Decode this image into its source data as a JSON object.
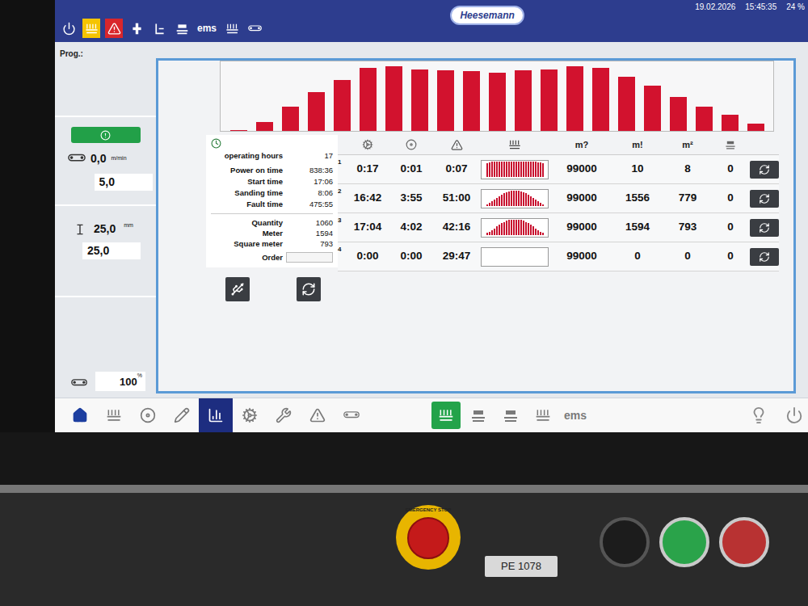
{
  "header": {
    "logo": "Heesemann",
    "date": "19.02.2026",
    "time": "15:45:35",
    "percent": "24 %",
    "icons": [
      {
        "kind": "power",
        "alert": false,
        "color": "#ffffff"
      },
      {
        "kind": "unit",
        "alert": true,
        "color": "#f5c400"
      },
      {
        "kind": "warning",
        "alert": true,
        "color": "#d9262c"
      },
      {
        "kind": "sensor",
        "alert": false,
        "color": "#ffffff"
      },
      {
        "kind": "thickness",
        "alert": false,
        "color": "#ffffff"
      },
      {
        "kind": "belt",
        "alert": false,
        "color": "#ffffff"
      },
      {
        "kind": "text",
        "label": "ems",
        "alert": false,
        "color": "#ffffff"
      },
      {
        "kind": "units",
        "alert": false,
        "color": "#ffffff"
      },
      {
        "kind": "conveyor",
        "alert": false,
        "color": "#ffffff"
      }
    ]
  },
  "program": {
    "label": "Prog.:"
  },
  "left_panel": {
    "status_ok": true,
    "feed": {
      "value": "0,0",
      "unit": "m/min",
      "setpoint": "5,0"
    },
    "thickness": {
      "value": "25,0",
      "unit": "mm",
      "setpoint": "25,0"
    },
    "speed": {
      "value": "100",
      "unit": "%"
    }
  },
  "chart": {
    "values": [
      1,
      14,
      37,
      60,
      79,
      97,
      100,
      95,
      94,
      92,
      90,
      94,
      95,
      100,
      97,
      84,
      70,
      52,
      37,
      25,
      11
    ]
  },
  "stats": {
    "title": "operating hours",
    "title_value": "17",
    "times": [
      {
        "label": "Power on time",
        "value": "838:36"
      },
      {
        "label": "Start time",
        "value": "17:06"
      },
      {
        "label": "Sanding time",
        "value": "8:06"
      },
      {
        "label": "Fault time",
        "value": "475:55"
      }
    ],
    "counts": [
      {
        "label": "Quantity",
        "value": "1060"
      },
      {
        "label": "Meter",
        "value": "1594"
      },
      {
        "label": "Square meter",
        "value": "793"
      }
    ],
    "order": {
      "label": "Order",
      "value": ""
    }
  },
  "table": {
    "columns": [
      "m?",
      "m!",
      "m²"
    ],
    "rows": [
      {
        "index": "1",
        "t1": "0:17",
        "t2": "0:01",
        "t3": "0:07",
        "profile": [
          88,
          92,
          95,
          96,
          97,
          98,
          98,
          99,
          99,
          100,
          100,
          100,
          100,
          100,
          99,
          99,
          98,
          98,
          97,
          96,
          95,
          94,
          92,
          88
        ],
        "target": "99000",
        "m": "10",
        "m2": "8",
        "count": "0"
      },
      {
        "index": "2",
        "t1": "16:42",
        "t2": "3:55",
        "t3": "51:00",
        "profile": [
          10,
          18,
          28,
          38,
          50,
          62,
          72,
          80,
          88,
          94,
          98,
          100,
          100,
          98,
          94,
          88,
          80,
          72,
          62,
          50,
          38,
          28,
          18,
          10
        ],
        "target": "99000",
        "m": "1556",
        "m2": "779",
        "count": "0"
      },
      {
        "index": "3",
        "t1": "17:04",
        "t2": "4:02",
        "t3": "42:16",
        "profile": [
          12,
          20,
          30,
          42,
          54,
          66,
          76,
          84,
          90,
          95,
          99,
          100,
          100,
          99,
          95,
          90,
          84,
          76,
          66,
          54,
          42,
          30,
          20,
          12
        ],
        "target": "99000",
        "m": "1594",
        "m2": "793",
        "count": "0"
      },
      {
        "index": "4",
        "t1": "0:00",
        "t2": "0:00",
        "t3": "29:47",
        "profile": [],
        "target": "99000",
        "m": "0",
        "m2": "0",
        "count": "0"
      }
    ]
  },
  "nav": {
    "left": [
      {
        "kind": "home",
        "selected": false
      },
      {
        "kind": "units",
        "selected": false
      },
      {
        "kind": "roller",
        "selected": false
      },
      {
        "kind": "pencil",
        "selected": false
      },
      {
        "kind": "chart",
        "selected": true
      },
      {
        "kind": "gears",
        "selected": false
      },
      {
        "kind": "wrench",
        "selected": false
      },
      {
        "kind": "warning",
        "selected": false
      },
      {
        "kind": "conveyor",
        "selected": false
      }
    ],
    "center": [
      {
        "kind": "sanding",
        "selected": true,
        "label": ""
      },
      {
        "kind": "hood",
        "selected": false,
        "label": ""
      },
      {
        "kind": "belt",
        "selected": false,
        "label": ""
      },
      {
        "kind": "units",
        "selected": false,
        "label": ""
      },
      {
        "kind": "text",
        "selected": false,
        "label": "ems"
      }
    ],
    "right": [
      {
        "kind": "bulb"
      },
      {
        "kind": "power"
      }
    ]
  },
  "machine_panel": {
    "estop": "EMERGENCY STOP",
    "plate": "PE 1078"
  }
}
